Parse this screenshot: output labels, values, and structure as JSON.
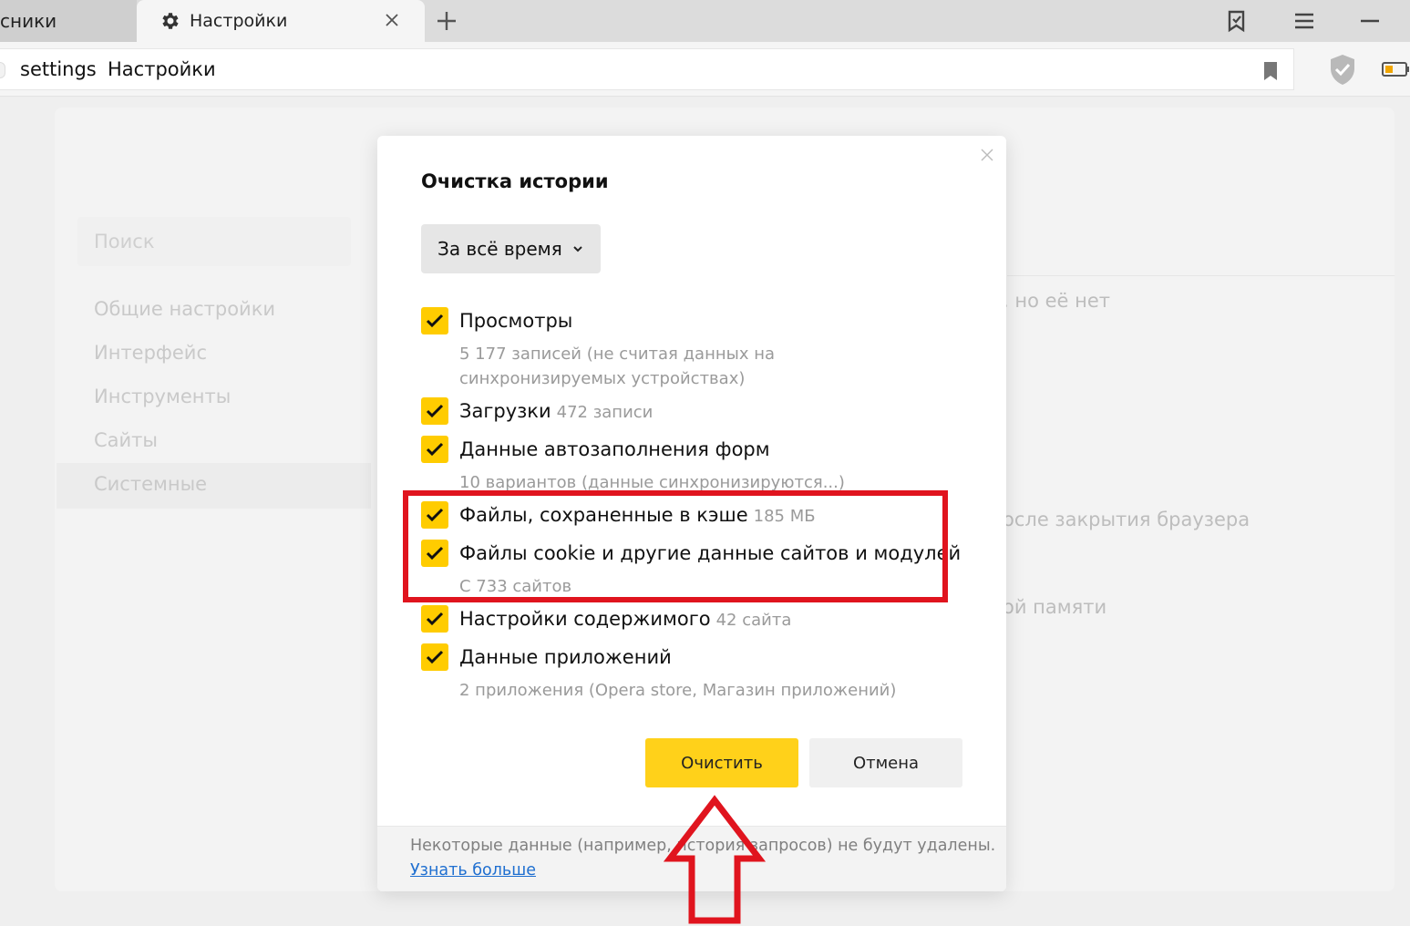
{
  "tabs": {
    "previous_tab_title": "сники",
    "active_tab_title": "Настройки"
  },
  "address_bar": {
    "host": "settings",
    "path": "Настройки"
  },
  "background_settings": {
    "search_placeholder": "Поиск",
    "nav_items": [
      "Общие настройки",
      "Интерфейс",
      "Инструменты",
      "Сайты",
      "Системные"
    ],
    "active_nav_item": "Системные",
    "right_fragments": [
      ", но её нет",
      "осле закрытия браузера",
      "ой памяти"
    ]
  },
  "dialog": {
    "title": "Очистка истории",
    "period_selected": "За всё время",
    "items": [
      {
        "label": "Просмотры",
        "count": "",
        "description": "5 177 записей (не считая данных на синхронизируемых устройствах)",
        "checked": true
      },
      {
        "label": "Загрузки",
        "count": "472 записи",
        "description": "",
        "checked": true
      },
      {
        "label": "Данные автозаполнения форм",
        "count": "",
        "description": "10 вариантов (данные синхронизируются...)",
        "checked": true
      },
      {
        "label": "Файлы, сохраненные в кэше",
        "count": "185 МБ",
        "description": "",
        "checked": true
      },
      {
        "label": "Файлы cookie и другие данные сайтов и модулей",
        "count": "",
        "description": "С 733 сайтов",
        "checked": true
      },
      {
        "label": "Настройки содержимого",
        "count": "42 сайта",
        "description": "",
        "checked": true
      },
      {
        "label": "Данные приложений",
        "count": "",
        "description": "2 приложения (Opera store, Магазин приложений)",
        "checked": true
      }
    ],
    "clear_button": "Очистить",
    "cancel_button": "Отмена",
    "footer_note": "Некоторые данные (например, история запросов) не будут удалены.",
    "footer_link": "Узнать больше"
  },
  "colors": {
    "accent_yellow": "#ffcc00",
    "annotation_red": "#e0141e",
    "link_blue": "#1f6fd0"
  },
  "icons": [
    "gear-icon",
    "close-icon",
    "plus-icon",
    "bookmarks-panel-icon",
    "menu-icon",
    "minimize-icon",
    "bookmark-icon",
    "protect-shield-icon",
    "battery-icon",
    "chevron-down-icon",
    "checkmark-icon"
  ]
}
